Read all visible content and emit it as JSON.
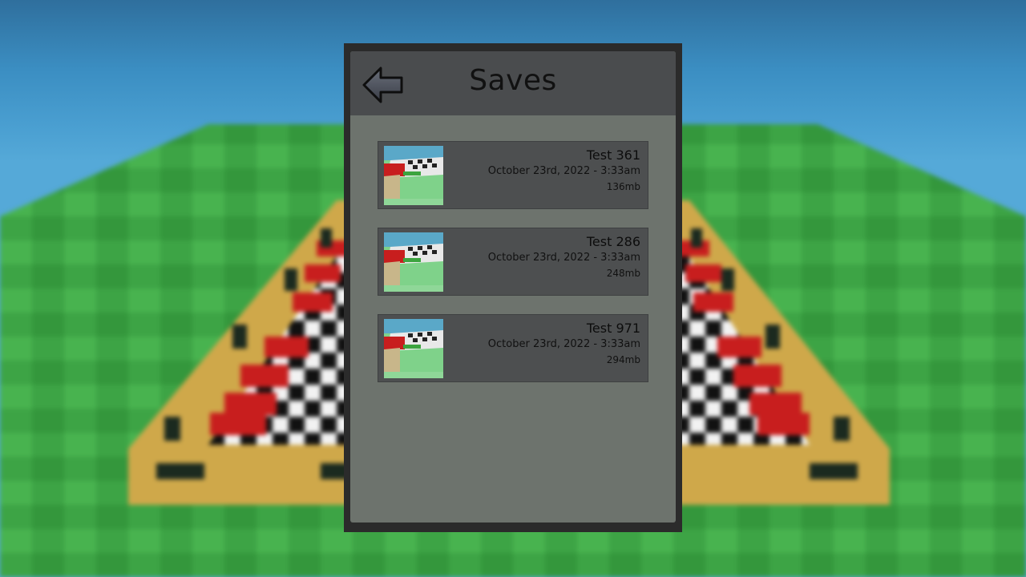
{
  "menu": {
    "title": "Saves",
    "back_icon": "arrow-left-icon"
  },
  "saves": [
    {
      "name": "Test 361",
      "date": "October 23rd, 2022 - 3:33am",
      "size": "136mb"
    },
    {
      "name": "Test 286",
      "date": "October 23rd, 2022 - 3:33am",
      "size": "248mb"
    },
    {
      "name": "Test 971",
      "date": "October 23rd, 2022 - 3:33am",
      "size": "294mb"
    }
  ],
  "colors": {
    "sky": "#4a9fd1",
    "grass": "#3aa543",
    "board_wood": "#cfa84a",
    "pieces": "#c81e1e",
    "panel_frame": "#2b2b2b",
    "panel_header": "#4a4c4e",
    "save_item": "#4d4f50"
  }
}
